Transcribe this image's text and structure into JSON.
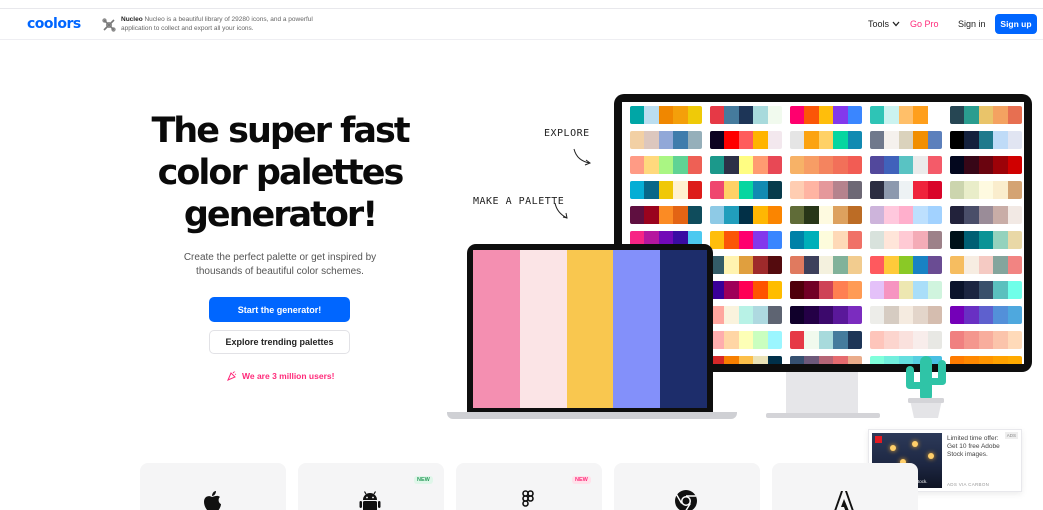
{
  "header": {
    "logo": "coolors",
    "ad_brand": "Nucleo",
    "ad_text": "Nucleo is a beautiful library of 29280 icons, and a powerful application to collect and export all your icons.",
    "nav": {
      "tools": "Tools",
      "go_pro": "Go Pro",
      "sign_in": "Sign in",
      "sign_up": "Sign up"
    }
  },
  "hero": {
    "title": "The super fast color palettes generator!",
    "subtitle": "Create the perfect palette or get inspired by thousands of beautiful color schemes.",
    "start_button": "Start the generator!",
    "explore_button": "Explore trending palettes",
    "users_text": "We are 3 million users!"
  },
  "labels": {
    "explore": "EXPLORE",
    "make_palette": "MAKE A PALETTE"
  },
  "laptop_palette": [
    "#f48fb1",
    "#fbe4e6",
    "#f9c74f",
    "#8390fa",
    "#1d2d6b"
  ],
  "monitor_palettes": [
    [
      [
        "#00a6a6",
        "#bbdef0",
        "#f08700",
        "#f49f0a",
        "#efca08"
      ],
      [
        "#e63946",
        "#457b9d",
        "#1d3557",
        "#a8dadc",
        "#f1faee"
      ],
      [
        "#ff006e",
        "#fb5607",
        "#ffbe0b",
        "#8338ec",
        "#3a86ff"
      ],
      [
        "#2ec4b6",
        "#cbf3f0",
        "#ffbf69",
        "#ff9f1c",
        "#ffffff"
      ],
      [
        "#264653",
        "#2a9d8f",
        "#e9c46a",
        "#f4a261",
        "#e76f51"
      ]
    ],
    [
      [
        "#f2d0a4",
        "#dcc7be",
        "#91a8d8",
        "#3f7cac",
        "#95afba"
      ],
      [
        "#0d0221",
        "#ff0000",
        "#ff5c5c",
        "#ffb400",
        "#f3e8ee"
      ],
      [
        "#e5e5e5",
        "#fca311",
        "#ffd166",
        "#06d6a0",
        "#118ab2"
      ],
      [
        "#70798c",
        "#f5f1ed",
        "#dad2bc",
        "#f18f01",
        "#5c80bc"
      ],
      [
        "#000000",
        "#14213d",
        "#1f7a8c",
        "#bfdbf7",
        "#e1e5f2"
      ]
    ],
    [
      [
        "#ff9b85",
        "#ffd97d",
        "#aaf683",
        "#60d394",
        "#ee6055"
      ],
      [
        "#1b998b",
        "#2d3047",
        "#fffd82",
        "#ff9b71",
        "#e84855"
      ],
      [
        "#f7b267",
        "#f79d65",
        "#f4845f",
        "#f27059",
        "#f25c54"
      ],
      [
        "#52489c",
        "#4062bb",
        "#59c3c3",
        "#ebebeb",
        "#f45b69"
      ],
      [
        "#03071e",
        "#370617",
        "#6a040f",
        "#9d0208",
        "#d00000"
      ]
    ],
    [
      [
        "#06aed5",
        "#086788",
        "#f0c808",
        "#fff1d0",
        "#dd1c1a"
      ],
      [
        "#ef476f",
        "#ffd166",
        "#06d6a0",
        "#118ab2",
        "#073b4c"
      ],
      [
        "#ffcdb2",
        "#ffb4a2",
        "#e5989b",
        "#b5838d",
        "#6d6875"
      ],
      [
        "#2b2d42",
        "#8d99ae",
        "#edf2f4",
        "#ef233c",
        "#d90429"
      ],
      [
        "#ccd5ae",
        "#e9edc9",
        "#fefae0",
        "#faedcd",
        "#d4a373"
      ]
    ],
    [
      [
        "#5f0f40",
        "#9a031e",
        "#fb8b24",
        "#e36414",
        "#0f4c5c"
      ],
      [
        "#8ecae6",
        "#219ebc",
        "#023047",
        "#ffb703",
        "#fb8500"
      ],
      [
        "#606c38",
        "#283618",
        "#fefae0",
        "#dda15e",
        "#bc6c25"
      ],
      [
        "#cdb4db",
        "#ffc8dd",
        "#ffafcc",
        "#bde0fe",
        "#a2d2ff"
      ],
      [
        "#22223b",
        "#4a4e69",
        "#9a8c98",
        "#c9ada7",
        "#f2e9e4"
      ]
    ],
    [
      [
        "#f72585",
        "#b5179e",
        "#7209b7",
        "#3a0ca3",
        "#4cc9f0"
      ],
      [
        "#ffbe0b",
        "#fb5607",
        "#ff006e",
        "#8338ec",
        "#3a86ff"
      ],
      [
        "#0081a7",
        "#00afb9",
        "#fdfcdc",
        "#fed9b7",
        "#f07167"
      ],
      [
        "#d8e2dc",
        "#ffe5d9",
        "#ffcad4",
        "#f4acb7",
        "#9d8189"
      ],
      [
        "#001219",
        "#005f73",
        "#0a9396",
        "#94d2bd",
        "#e9d8a6"
      ]
    ],
    [
      [
        "#9b5de5",
        "#f15bb5",
        "#fee440",
        "#00bbf9",
        "#00f5d4"
      ],
      [
        "#335c67",
        "#fff3b0",
        "#e09f3e",
        "#9e2a2b",
        "#540b0e"
      ],
      [
        "#e07a5f",
        "#3d405b",
        "#f4f1de",
        "#81b29a",
        "#f2cc8f"
      ],
      [
        "#ff595e",
        "#ffca3a",
        "#8ac926",
        "#1982c4",
        "#6a4c93"
      ],
      [
        "#f6bd60",
        "#f7ede2",
        "#f5cac3",
        "#84a59d",
        "#f28482"
      ]
    ],
    [
      [
        "#ff70a6",
        "#ff9770",
        "#ffd670",
        "#e9ff70",
        "#70d6ff"
      ],
      [
        "#390099",
        "#9e0059",
        "#ff0054",
        "#ff5400",
        "#ffbd00"
      ],
      [
        "#4f000b",
        "#720026",
        "#ce4257",
        "#ff7f51",
        "#ff9b54"
      ],
      [
        "#e4c1f9",
        "#f694c1",
        "#ede7b1",
        "#a9def9",
        "#d0f4de"
      ],
      [
        "#0b132b",
        "#1c2541",
        "#3a506b",
        "#5bc0be",
        "#6fffe9"
      ]
    ],
    [
      [
        "#f94144",
        "#f3722c",
        "#f8961e",
        "#f9c74f",
        "#90be6d"
      ],
      [
        "#ffa69e",
        "#faf3dd",
        "#b8f2e6",
        "#aed9e0",
        "#5e6472"
      ],
      [
        "#10002b",
        "#240046",
        "#3c096c",
        "#5a189a",
        "#7b2cbf"
      ],
      [
        "#edede9",
        "#d6ccc2",
        "#f5ebe0",
        "#e3d5ca",
        "#d5bdaf"
      ],
      [
        "#7400b8",
        "#6930c3",
        "#5e60ce",
        "#5390d9",
        "#4ea8de"
      ]
    ],
    [
      [
        "#2d00f7",
        "#6a00f4",
        "#8900f2",
        "#a100f2",
        "#b100e8"
      ],
      [
        "#ffadad",
        "#ffd6a5",
        "#fdffb6",
        "#caffbf",
        "#9bf6ff"
      ],
      [
        "#e63946",
        "#f1faee",
        "#a8dadc",
        "#457b9d",
        "#1d3557"
      ],
      [
        "#fec5bb",
        "#fcd5ce",
        "#fae1dd",
        "#f8edeb",
        "#e8e8e4"
      ],
      [
        "#f08080",
        "#f4978e",
        "#f8ad9d",
        "#fbc4ab",
        "#ffdab9"
      ]
    ],
    [
      [
        "#006d77",
        "#83c5be",
        "#edf6f9",
        "#ffddd2",
        "#e29578"
      ],
      [
        "#d62828",
        "#f77f00",
        "#fcbf49",
        "#eae2b7",
        "#003049"
      ],
      [
        "#355070",
        "#6d597a",
        "#b56576",
        "#e56b6f",
        "#eaac8b"
      ],
      [
        "#80ffdb",
        "#72efdd",
        "#64dfdf",
        "#56cfe1",
        "#48bfe3"
      ],
      [
        "#ff7b00",
        "#ff8800",
        "#ff9500",
        "#ffa200",
        "#ffaa00"
      ]
    ],
    [
      [
        "#ffe5ec",
        "#ffc2d1",
        "#ffb3c6",
        "#ff8fab",
        "#fb6f92"
      ],
      [
        "#0466c8",
        "#0353a4",
        "#023e7d",
        "#002855",
        "#001845"
      ],
      [
        "#f8f9fa",
        "#e9ecef",
        "#dee2e6",
        "#ced4da",
        "#adb5bd"
      ],
      [
        "#ff4d6d",
        "#ff758f",
        "#ff8fa3",
        "#ffb3c1",
        "#ffccd5"
      ],
      [
        "#d9ed92",
        "#b5e48c",
        "#99d98c",
        "#76c893",
        "#52b69a"
      ]
    ],
    [
      [
        "#03045e",
        "#0077b6",
        "#00b4d8",
        "#90e0ef",
        "#caf0f8"
      ],
      [
        "#fb6107",
        "#f3de2c",
        "#7cb518",
        "#5c8001",
        "#fbb02d"
      ],
      [
        "#6f1d1b",
        "#bb9457",
        "#432818",
        "#99582a",
        "#ffe6a7"
      ],
      [
        "#ff9f1c",
        "#ffbf69",
        "#ffffff",
        "#cbf3f0",
        "#2ec4b6"
      ],
      [
        "#f4f1bb",
        "#9bc1bc",
        "#5ca4a9",
        "#e6ebe0",
        "#ed6a5a"
      ]
    ],
    [
      [
        "#533747",
        "#5f506b",
        "#6a6b83",
        "#76949f",
        "#86bbbd"
      ],
      [
        "#ffcad4",
        "#b0d0d3",
        "#c08497",
        "#f7af9d",
        "#f3e9dc"
      ],
      [
        "#1a535c",
        "#4ecdc4",
        "#f7fff7",
        "#ff6b6b",
        "#ffe66d"
      ],
      [
        "#390040",
        "#6c0e23",
        "#c42021",
        "#f3ffb9",
        "#f0a202"
      ],
      [
        "#2f4858",
        "#33658a",
        "#86bbd8",
        "#f6ae2d",
        "#f26419"
      ]
    ]
  ],
  "ad_card": {
    "text": "Limited time offer: Get 10 free Adobe Stock images.",
    "caption": "Make it with Adobe Stock.",
    "brand": "ADS VIA CARBON",
    "badge": "ADS"
  },
  "bottom_cards": [
    {
      "icon": "apple-icon",
      "badge": ""
    },
    {
      "icon": "android-icon",
      "badge": "NEW"
    },
    {
      "icon": "figma-icon",
      "badge": "NEW"
    },
    {
      "icon": "chrome-icon",
      "badge": ""
    },
    {
      "icon": "adobe-icon",
      "badge": ""
    }
  ],
  "colors": {
    "accent": "#0066ff",
    "pink": "#ff2a7a",
    "new_badge_green": "#dff6e9",
    "new_badge_pink": "#ffe1ea"
  }
}
